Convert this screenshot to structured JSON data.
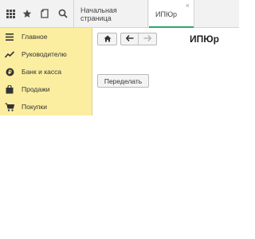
{
  "toolbar": {
    "icons": [
      "apps-grid-icon",
      "star-icon",
      "history-icon",
      "search-icon"
    ]
  },
  "tabs": [
    {
      "label": "Начальная страница",
      "active": false
    },
    {
      "label": "ИПЮр",
      "active": true,
      "close": "×"
    }
  ],
  "sidebar": {
    "background": "#fbeea0",
    "items": [
      {
        "label": "Главное",
        "icon": "menu-lines-icon"
      },
      {
        "label": "Руководителю",
        "icon": "trend-chart-icon"
      },
      {
        "label": "Банк и касса",
        "icon": "coin-icon"
      },
      {
        "label": "Продажи",
        "icon": "sales-bag-icon"
      },
      {
        "label": "Покупки",
        "icon": "shopping-cart-icon"
      }
    ]
  },
  "main": {
    "title": "ИПЮр",
    "change_button": "Переделать"
  },
  "colors": {
    "accent": "#2aa86a",
    "topbar": "#f2f2f2"
  }
}
